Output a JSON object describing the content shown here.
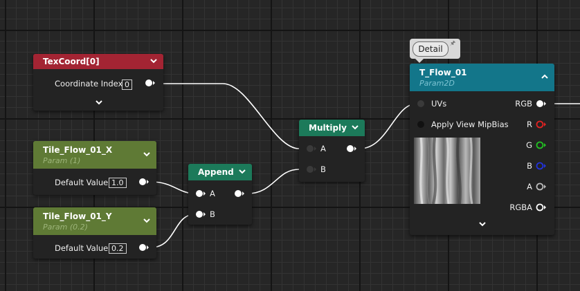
{
  "colors": {
    "texcoord_header": "#a32433",
    "param_header": "#5f7a35",
    "op_header": "#1c7a5a",
    "texture_header": "#13768a",
    "red_pin": "#e32222",
    "green_pin": "#22c122",
    "blue_pin": "#2233dd"
  },
  "texcoord": {
    "title": "TexCoord[0]",
    "input_label": "Coordinate Index",
    "input_value": "0"
  },
  "tile_x": {
    "title": "Tile_Flow_01_X",
    "subtitle": "Param (1)",
    "label": "Default Value",
    "value": "1.0"
  },
  "tile_y": {
    "title": "Tile_Flow_01_Y",
    "subtitle": "Param (0.2)",
    "label": "Default Value",
    "value": "0.2"
  },
  "append": {
    "title": "Append",
    "pin_a": "A",
    "pin_b": "B"
  },
  "multiply": {
    "title": "Multiply",
    "pin_a": "A",
    "pin_b": "B"
  },
  "texture": {
    "title": "T_Flow_01",
    "subtitle": "Param2D",
    "inputs": [
      "UVs",
      "Apply View MipBias"
    ],
    "outputs": [
      "RGB",
      "R",
      "G",
      "B",
      "A",
      "RGBA"
    ]
  },
  "detail": {
    "label": "Detail"
  },
  "icons": [
    "chevron-down-icon",
    "chevron-up-icon",
    "pin-icon",
    "thumbnail-image"
  ]
}
